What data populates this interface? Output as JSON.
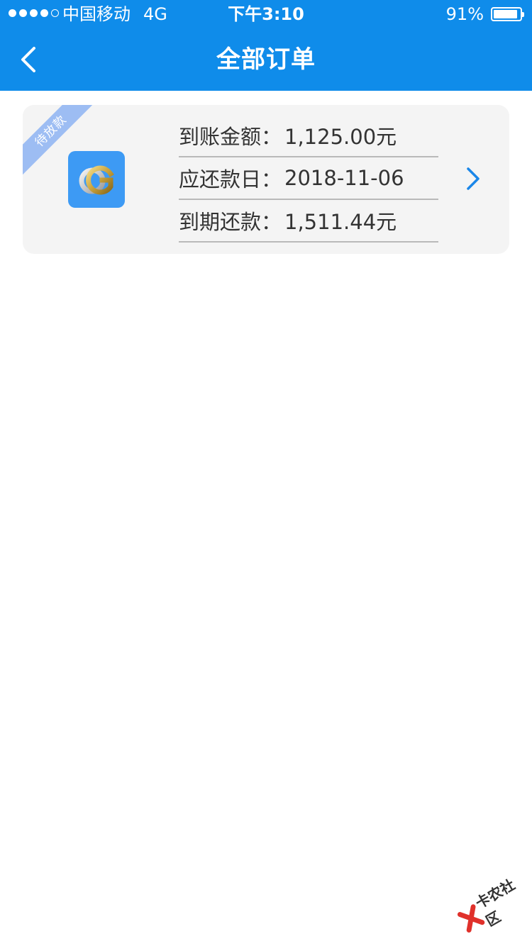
{
  "status_bar": {
    "carrier": "中国移动",
    "network": "4G",
    "time": "下午3:10",
    "battery": "91%",
    "battery_level": 0.91,
    "signal_bars": 4,
    "signal_max": 5
  },
  "header": {
    "title": "全部订单",
    "background_color": "#0f8cea"
  },
  "orders": [
    {
      "status_tag": "待放款",
      "app_icon": "gold-g-logo-icon",
      "fields": [
        {
          "label": "到账金额：",
          "value": "1,125.00元"
        },
        {
          "label": "应还款日：",
          "value": "2018-11-06"
        },
        {
          "label": "到期还款：",
          "value": "1,511.44元"
        }
      ]
    }
  ],
  "watermark": {
    "text": "卡农社区"
  }
}
